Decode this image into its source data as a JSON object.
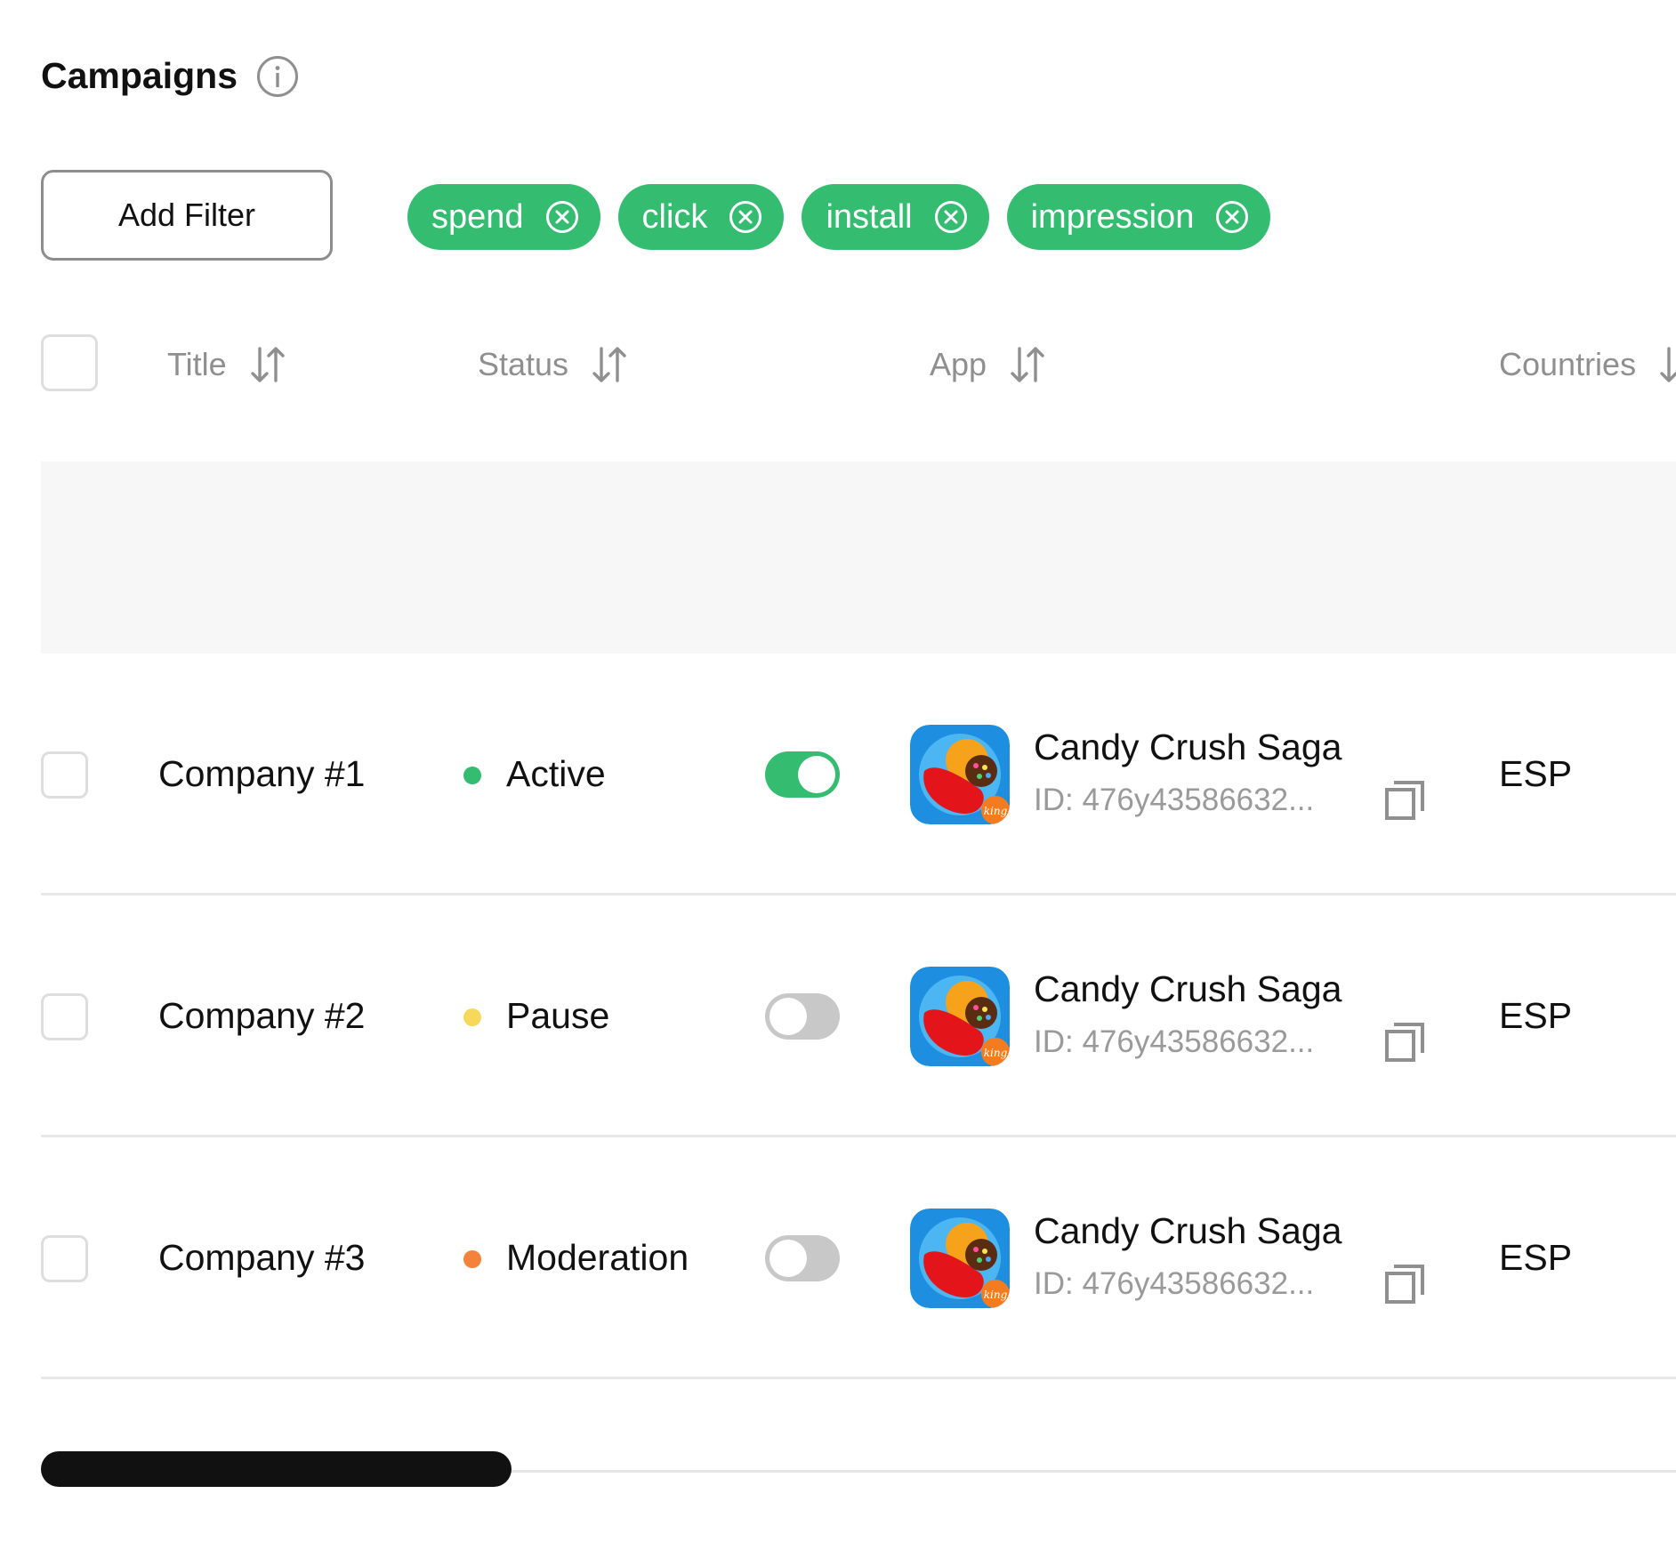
{
  "header": {
    "title": "Campaigns",
    "info_icon": "info-icon"
  },
  "filters": {
    "add_label": "Add Filter",
    "chips": [
      {
        "label": "spend",
        "icon": "close-circle-icon"
      },
      {
        "label": "click",
        "icon": "close-circle-icon"
      },
      {
        "label": "install",
        "icon": "close-circle-icon"
      },
      {
        "label": "impression",
        "icon": "close-circle-icon"
      }
    ]
  },
  "table": {
    "columns": [
      {
        "label": "Title",
        "icon": "sort-icon"
      },
      {
        "label": "Status",
        "icon": "sort-icon"
      },
      {
        "label": "App",
        "icon": "sort-icon"
      },
      {
        "label": "Countries",
        "icon": "sort-icon"
      }
    ],
    "rows": [
      {
        "title": "Company #1",
        "status": "Active",
        "status_color": "#34bd70",
        "enabled": true,
        "app_name": "Candy Crush Saga",
        "app_id": "ID: 476y43586632...",
        "country": "ESP"
      },
      {
        "title": "Company #2",
        "status": "Pause",
        "status_color": "#f6d95a",
        "enabled": false,
        "app_name": "Candy Crush Saga",
        "app_id": "ID: 476y43586632...",
        "country": "ESP"
      },
      {
        "title": "Company #3",
        "status": "Moderation",
        "status_color": "#f5823a",
        "enabled": false,
        "app_name": "Candy Crush Saga",
        "app_id": "ID: 476y43586632...",
        "country": "ESP"
      }
    ]
  },
  "colors": {
    "accent": "#34bd70",
    "toggle_off": "#c8c8c8"
  }
}
